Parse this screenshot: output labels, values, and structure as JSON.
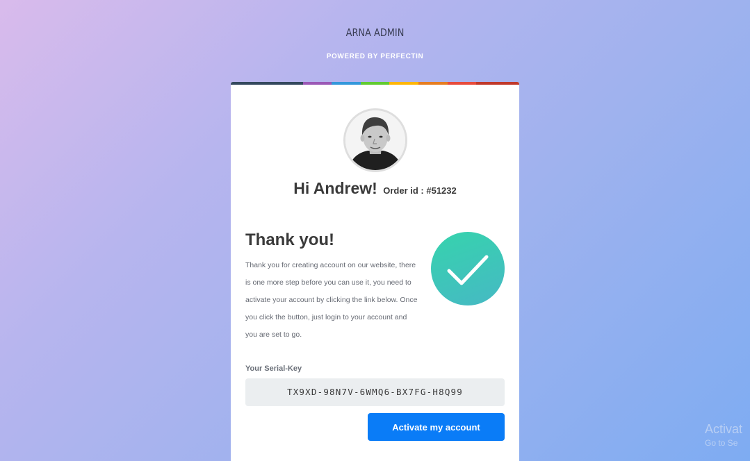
{
  "header": {
    "brand": "ARNA ADMIN",
    "powered_by": "POWERED BY PERFECTIN"
  },
  "card": {
    "top_strip_colors": [
      "#34495e",
      "#9b59b6",
      "#3498db",
      "#62cb31",
      "#ffb606",
      "#e67e22",
      "#e74c3c",
      "#c0392b"
    ],
    "avatar_icon": "user-avatar-photo",
    "greeting": "Hi Andrew!",
    "order_id": "Order id : #51232",
    "thank_you_title": "Thank you!",
    "message": "Thank you for creating account on our website, there is one more step before you can use it, you need to activate your account by clicking the link below. Once you click the button, just login to your account and you are set to go.",
    "success_icon": "check-icon",
    "success_color": "#3ccab5",
    "serial_label": "Your Serial-Key",
    "serial_key": "TX9XD-98N7V-6WMQ6-BX7FG-H8Q99",
    "activate_label": "Activate my account",
    "activate_color": "#0a7cf7"
  },
  "watermark": {
    "title": "Activat",
    "subtitle": "Go to Se"
  }
}
